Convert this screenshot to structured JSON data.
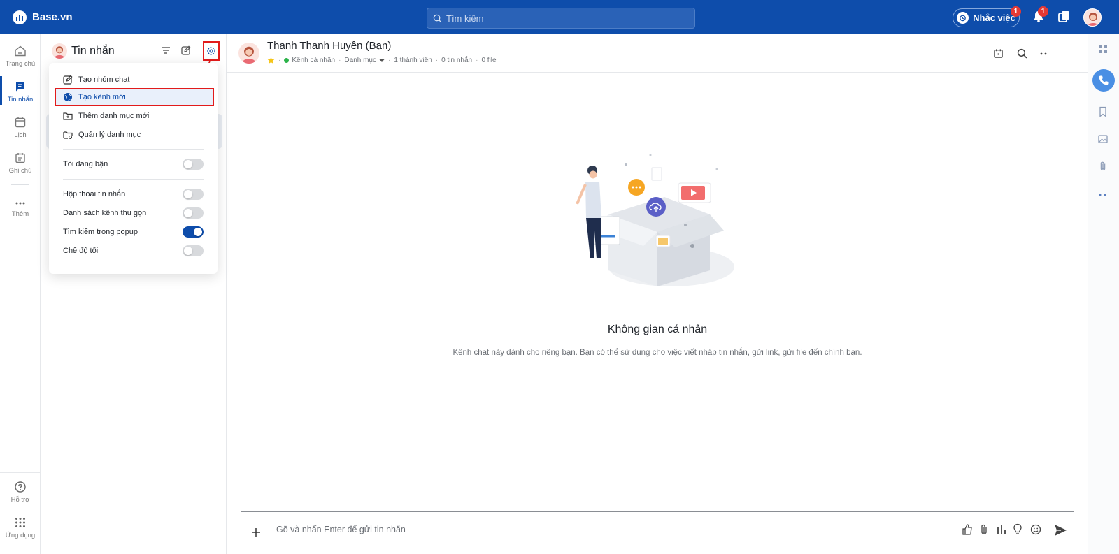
{
  "topbar": {
    "brand": "Base.vn",
    "search_placeholder": "Tìm kiếm",
    "remind_label": "Nhắc việc",
    "remind_badge": "1",
    "notif_badge": "1"
  },
  "rail": {
    "items": [
      {
        "label": "Trang chủ"
      },
      {
        "label": "Tin nhắn"
      },
      {
        "label": "Lịch"
      },
      {
        "label": "Ghi chú"
      },
      {
        "label": "Thêm"
      }
    ],
    "bottom": [
      {
        "label": "Hỗ trợ"
      },
      {
        "label": "Ứng dụng"
      }
    ]
  },
  "panel": {
    "title": "Tin nhắn"
  },
  "menu": {
    "items": [
      {
        "label": "Tạo nhóm chat"
      },
      {
        "label": "Tạo kênh mới"
      },
      {
        "label": "Thêm danh mục mới"
      },
      {
        "label": "Quản lý danh mục"
      }
    ],
    "toggles": [
      {
        "label": "Tôi đang bận",
        "on": false
      },
      {
        "label": "Hộp thoại tin nhắn",
        "on": false
      },
      {
        "label": "Danh sách kênh thu gọn",
        "on": false
      },
      {
        "label": "Tìm kiếm trong popup",
        "on": true
      },
      {
        "label": "Chế độ tối",
        "on": false
      }
    ]
  },
  "chat": {
    "name": "Thanh Thanh Huyền (Bạn)",
    "channel_type": "Kênh cá nhân",
    "category": "Danh mục",
    "members": "1 thành viên",
    "messages": "0 tin nhắn",
    "files": "0 file"
  },
  "empty": {
    "title": "Không gian cá nhân",
    "description": "Kênh chat này dành cho riêng bạn. Bạn có thể sử dụng cho việc viết nháp tin nhắn, gửi link, gửi file đến chính bạn."
  },
  "composer": {
    "placeholder": "Gõ và nhấn Enter để gửi tin nhắn"
  },
  "colors": {
    "brand": "#0e4dab",
    "highlight": "#e21b1b",
    "online": "#2cb34a"
  }
}
